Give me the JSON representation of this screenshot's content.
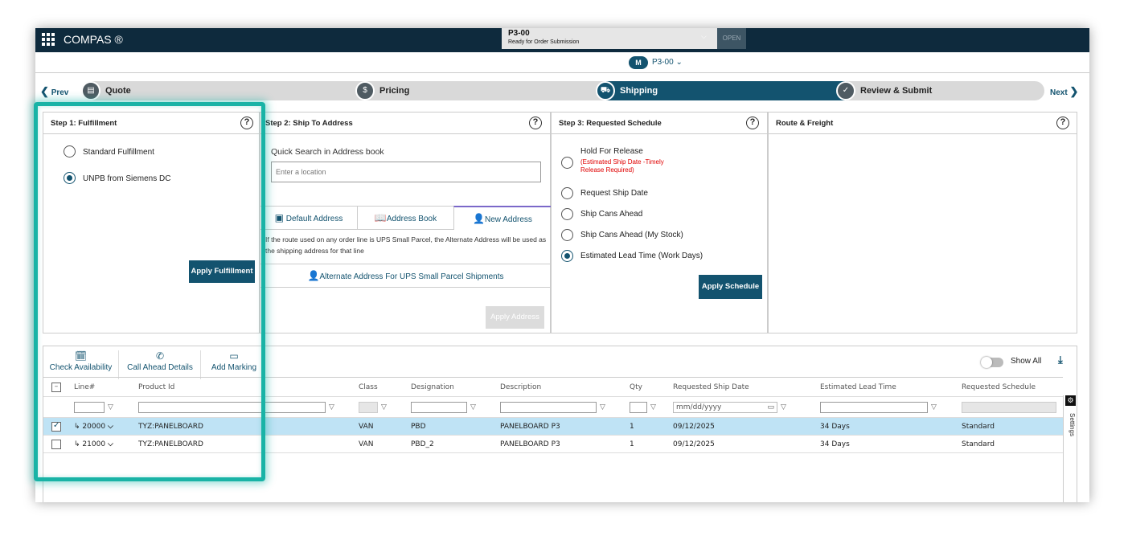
{
  "topbar": {
    "app_title": "COMPAS ®",
    "doc_id": "P3-00",
    "doc_status": "Ready for Order Submission",
    "open_badge": "OPEN"
  },
  "subheader": {
    "badge": "M",
    "doc": "P3-00 ⌄"
  },
  "stepper": {
    "prev": "Prev",
    "next": "Next",
    "steps": [
      {
        "label": "Quote",
        "icon": "document-icon"
      },
      {
        "label": "Pricing",
        "icon": "dollar-icon"
      },
      {
        "label": "Shipping",
        "icon": "truck-icon"
      },
      {
        "label": "Review & Submit",
        "icon": "check-icon"
      }
    ]
  },
  "step1": {
    "title": "Step 1: Fulfillment",
    "options": [
      "Standard Fulfillment",
      "UNPB from Siemens DC"
    ],
    "selected": 1,
    "apply": "Apply Fulfillment"
  },
  "step2": {
    "title": "Step 2: Ship To Address",
    "search_label": "Quick Search in Address book",
    "search_placeholder": "Enter a location",
    "tabs": [
      "Default Address",
      "Address Book",
      "New Address"
    ],
    "note": "If the route used on any order line is UPS Small Parcel, the Alternate Address will be used as the shipping address for that line",
    "alt_link": "Alternate Address For UPS Small Parcel Shipments",
    "apply": "Apply Address"
  },
  "step3": {
    "title": "Step 3: Requested Schedule",
    "hold_label": "Hold For Release",
    "hold_note": "(Estimated Ship Date -Timely Release Required)",
    "options": [
      "Request Ship Date",
      "Ship Cans Ahead",
      "Ship Cans Ahead (My Stock)",
      "Estimated Lead Time (Work Days)"
    ],
    "apply": "Apply Schedule"
  },
  "route": {
    "title": "Route & Freight"
  },
  "toolbar": {
    "check": "Check Availability",
    "call": "Call Ahead Details",
    "marking": "Add Marking",
    "show_all": "Show All"
  },
  "table": {
    "headers": [
      "Line#",
      "Product Id",
      "Class",
      "Designation",
      "Description",
      "Qty",
      "Requested Ship Date",
      "Estimated Lead Time",
      "Requested Schedule"
    ],
    "date_placeholder": "mm/dd/yyyy",
    "rows": [
      {
        "line": "20000",
        "product": "TYZ:PANELBOARD",
        "class": "VAN",
        "designation": "PBD",
        "description": "PANELBOARD P3",
        "qty": "1",
        "ship_date": "09/12/2025",
        "lead_time": "34 Days",
        "schedule": "Standard"
      },
      {
        "line": "21000",
        "product": "TYZ:PANELBOARD",
        "class": "VAN",
        "designation": "PBD_2",
        "description": "PANELBOARD P3",
        "qty": "1",
        "ship_date": "09/12/2025",
        "lead_time": "34 Days",
        "schedule": "Standard"
      }
    ]
  },
  "settings_label": "Settings",
  "colors": {
    "navy": "#0e2a3d",
    "teal_blue": "#13536f",
    "highlight": "#19b3a6",
    "selected_row": "#bfe3f5",
    "warning_red": "#e00000"
  }
}
